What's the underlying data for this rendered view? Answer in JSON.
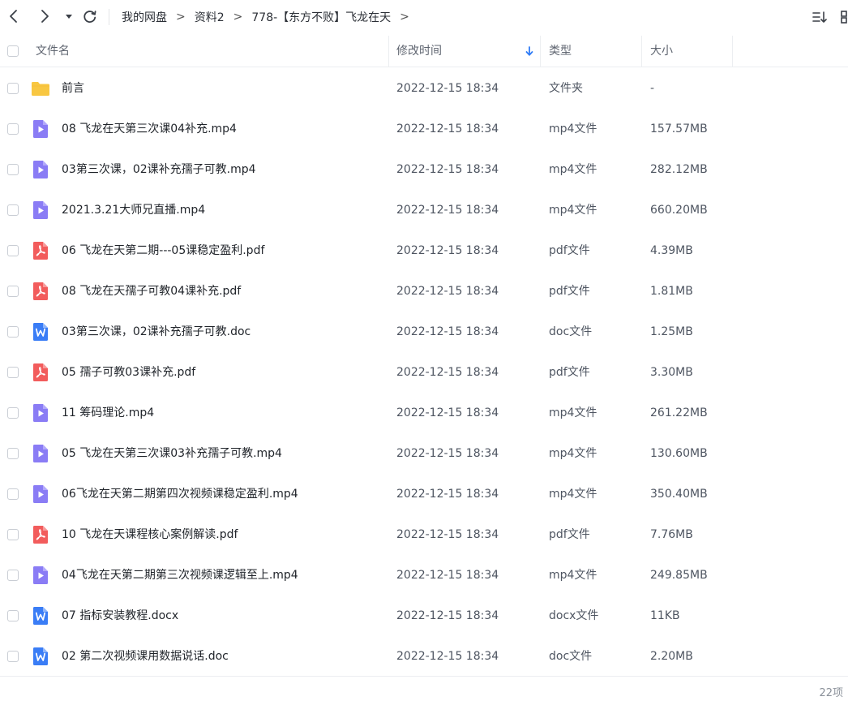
{
  "breadcrumb": [
    "我的网盘",
    "资料2",
    "778-【东方不败】飞龙在天"
  ],
  "breadcrumb_sep": ">",
  "columns": {
    "name": "文件名",
    "modified": "修改时间",
    "type": "类型",
    "size": "大小"
  },
  "sort": {
    "column": "modified",
    "direction": "desc",
    "arrow_color": "#2f7cf6"
  },
  "colors": {
    "folder": "#f8c742",
    "video": "#8a7cf5",
    "pdf": "#f25c5c",
    "doc": "#3a7df6"
  },
  "files": [
    {
      "name": "前言",
      "icon": "folder-icon",
      "modified": "2022-12-15 18:34",
      "type": "文件夹",
      "size": "-"
    },
    {
      "name": "08 飞龙在天第三次课04补充.mp4",
      "icon": "video-file-icon",
      "modified": "2022-12-15 18:34",
      "type": "mp4文件",
      "size": "157.57MB"
    },
    {
      "name": "03第三次课，02课补充孺子可教.mp4",
      "icon": "video-file-icon",
      "modified": "2022-12-15 18:34",
      "type": "mp4文件",
      "size": "282.12MB"
    },
    {
      "name": "2021.3.21大师兄直播.mp4",
      "icon": "video-file-icon",
      "modified": "2022-12-15 18:34",
      "type": "mp4文件",
      "size": "660.20MB"
    },
    {
      "name": "06 飞龙在天第二期---05课稳定盈利.pdf",
      "icon": "pdf-file-icon",
      "modified": "2022-12-15 18:34",
      "type": "pdf文件",
      "size": "4.39MB"
    },
    {
      "name": "08 飞龙在天孺子可教04课补充.pdf",
      "icon": "pdf-file-icon",
      "modified": "2022-12-15 18:34",
      "type": "pdf文件",
      "size": "1.81MB"
    },
    {
      "name": "03第三次课，02课补充孺子可教.doc",
      "icon": "word-file-icon",
      "modified": "2022-12-15 18:34",
      "type": "doc文件",
      "size": "1.25MB"
    },
    {
      "name": "05 孺子可教03课补充.pdf",
      "icon": "pdf-file-icon",
      "modified": "2022-12-15 18:34",
      "type": "pdf文件",
      "size": "3.30MB"
    },
    {
      "name": "11 筹码理论.mp4",
      "icon": "video-file-icon",
      "modified": "2022-12-15 18:34",
      "type": "mp4文件",
      "size": "261.22MB"
    },
    {
      "name": "05 飞龙在天第三次课03补充孺子可教.mp4",
      "icon": "video-file-icon",
      "modified": "2022-12-15 18:34",
      "type": "mp4文件",
      "size": "130.60MB"
    },
    {
      "name": "06飞龙在天第二期第四次视频课稳定盈利.mp4",
      "icon": "video-file-icon",
      "modified": "2022-12-15 18:34",
      "type": "mp4文件",
      "size": "350.40MB"
    },
    {
      "name": "10 飞龙在天课程核心案例解读.pdf",
      "icon": "pdf-file-icon",
      "modified": "2022-12-15 18:34",
      "type": "pdf文件",
      "size": "7.76MB"
    },
    {
      "name": "04飞龙在天第二期第三次视频课逻辑至上.mp4",
      "icon": "video-file-icon",
      "modified": "2022-12-15 18:34",
      "type": "mp4文件",
      "size": "249.85MB"
    },
    {
      "name": "07 指标安装教程.docx",
      "icon": "word-file-icon",
      "modified": "2022-12-15 18:34",
      "type": "docx文件",
      "size": "11KB"
    },
    {
      "name": "02 第二次视频课用数据说话.doc",
      "icon": "word-file-icon",
      "modified": "2022-12-15 18:34",
      "type": "doc文件",
      "size": "2.20MB"
    }
  ],
  "item_count": "22项"
}
